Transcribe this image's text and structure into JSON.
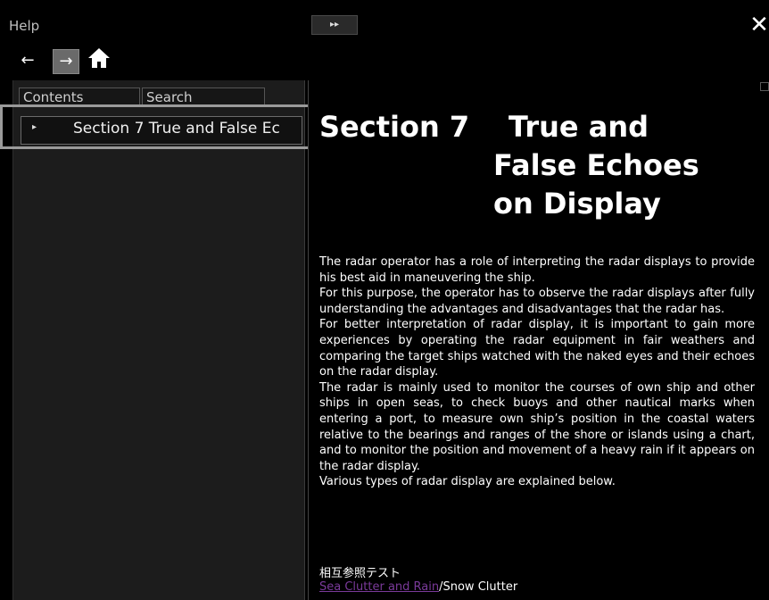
{
  "window": {
    "title": "Help",
    "toggle_label": "▸▸",
    "close_label": "✕"
  },
  "toolbar": {
    "back_icon": "←",
    "forward_icon": "→",
    "home_icon": "home-icon"
  },
  "left_pane": {
    "tabs": [
      {
        "label": "Contents"
      },
      {
        "label": "Search"
      }
    ],
    "tree": [
      {
        "label": "Section 7 True and False Ec",
        "expanded": false
      }
    ]
  },
  "content": {
    "heading": {
      "section": "Section 7",
      "title_line1": "True and",
      "title_line2": "False Echoes",
      "title_line3": "on Display"
    },
    "paragraphs": [
      "The radar operator has a role of interpreting the radar displays to provide his best aid in maneuvering the ship.",
      "For this purpose, the operator has to observe the radar displays after fully understanding the advantages and disadvantages that the radar has.",
      "For better interpretation of radar display, it is important to gain more experiences by operating the radar equipment in fair weathers and comparing the target ships watched with the naked eyes and their echoes on the radar display.",
      "The radar is mainly used to monitor the courses of own ship and other ships in open seas, to check buoys and other nautical marks when entering a port, to measure own ship’s position in the coastal waters relative to the bearings and ranges of the shore or islands using a chart, and to monitor the position and movement of a heavy rain if it appears on the radar display.",
      "Various types of radar display are explained below."
    ],
    "cross_ref_label": "相互参照テスト",
    "link_text": "Sea Clutter and Rain",
    "link_suffix": "/Snow Clutter"
  },
  "colors": {
    "background": "#000000",
    "pane": "#1c1c1c",
    "link": "#7a3a9a",
    "highlight_frame": "#9a9a9a"
  }
}
